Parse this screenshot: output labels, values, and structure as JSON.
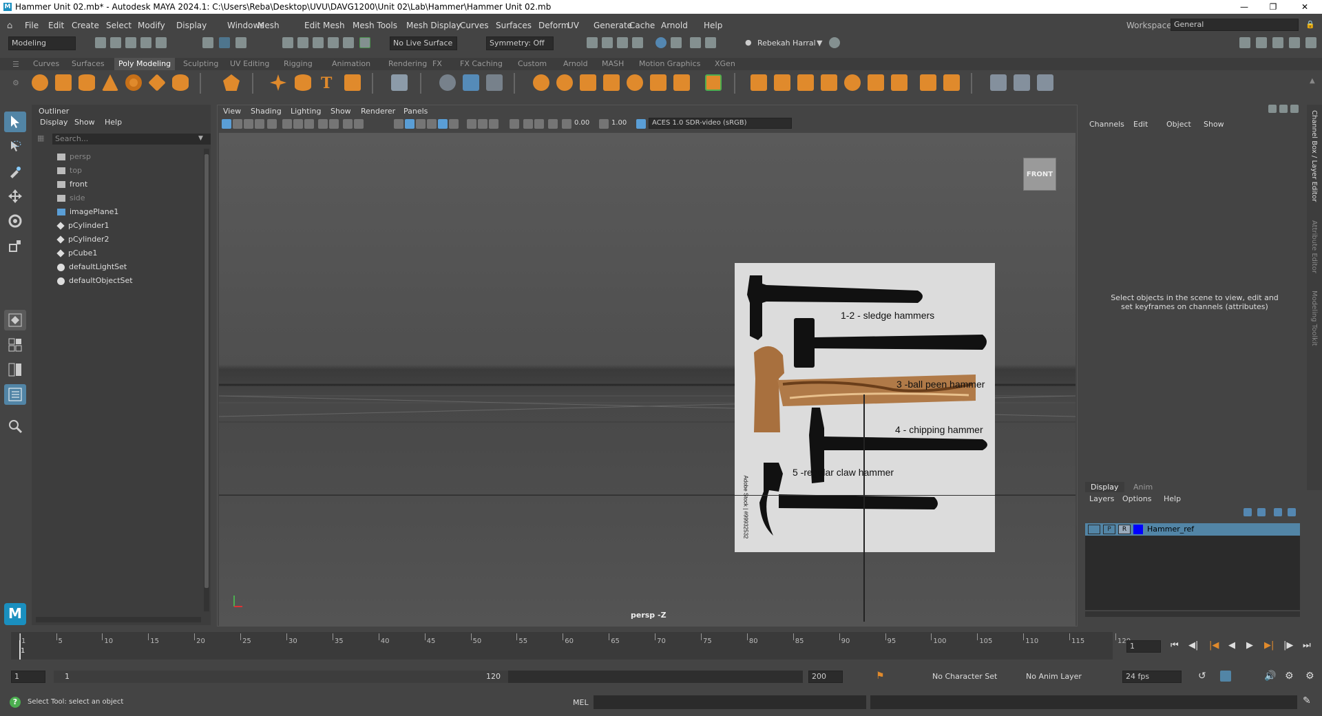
{
  "window": {
    "title": "Hammer Unit 02.mb* - Autodesk MAYA 2024.1: C:\\Users\\Reba\\Desktop\\UVU\\DAVG1200\\Unit 02\\Lab\\Hammer\\Hammer Unit 02.mb",
    "logo": "maya-logo-icon"
  },
  "menubar": {
    "items": [
      "File",
      "Edit",
      "Create",
      "Select",
      "Modify",
      "Display",
      "Windows",
      "Mesh",
      "Edit Mesh",
      "Mesh Tools",
      "Mesh Display",
      "Curves",
      "Surfaces",
      "Deform",
      "UV",
      "Generate",
      "Cache",
      "Arnold",
      "Help"
    ],
    "workspace_label": "Workspace:",
    "workspace_value": "General"
  },
  "statusline": {
    "menuset": "Modeling",
    "live_surface": "No Live Surface",
    "symmetry": "Symmetry: Off",
    "user": "Rebekah Harral"
  },
  "shelf": {
    "tabs": [
      "Curves",
      "Surfaces",
      "Poly Modeling",
      "Sculpting",
      "UV Editing",
      "Rigging",
      "Animation",
      "Rendering",
      "FX",
      "FX Caching",
      "Custom",
      "Arnold",
      "MASH",
      "Motion Graphics",
      "XGen"
    ],
    "active_tab": "Poly Modeling"
  },
  "outliner": {
    "title": "Outliner",
    "menus": [
      "Display",
      "Show",
      "Help"
    ],
    "search_placeholder": "Search...",
    "items": [
      {
        "label": "persp",
        "icon": "camera-icon",
        "dim": true
      },
      {
        "label": "top",
        "icon": "camera-icon",
        "dim": true
      },
      {
        "label": "front",
        "icon": "camera-icon",
        "dim": false
      },
      {
        "label": "side",
        "icon": "camera-icon",
        "dim": true
      },
      {
        "label": "imagePlane1",
        "icon": "image-plane-icon",
        "dim": false
      },
      {
        "label": "pCylinder1",
        "icon": "mesh-icon",
        "dim": false
      },
      {
        "label": "pCylinder2",
        "icon": "mesh-icon",
        "dim": false
      },
      {
        "label": "pCube1",
        "icon": "mesh-icon",
        "dim": false
      },
      {
        "label": "defaultLightSet",
        "icon": "set-icon",
        "dim": false
      },
      {
        "label": "defaultObjectSet",
        "icon": "set-icon",
        "dim": false
      }
    ]
  },
  "viewport": {
    "menus": [
      "View",
      "Shading",
      "Lighting",
      "Show",
      "Renderer",
      "Panels"
    ],
    "exposure": "0.00",
    "gamma": "1.00",
    "colorspace": "ACES 1.0 SDR-video (sRGB)",
    "camera_label": "persp -Z",
    "viewcube_label": "FRONT",
    "reference_labels": [
      "1-2 - sledge hammers",
      "3 -ball peen hammer",
      "4 - chipping hammer",
      "5 -regular claw hammer"
    ],
    "reference_credit": "Adobe Stock | #99932532"
  },
  "channelbox": {
    "menus": [
      "Channels",
      "Edit",
      "Object",
      "Show"
    ],
    "hint": "Select objects in the scene to view, edit and set keyframes on channels (attributes)",
    "side_tabs": [
      "Channel Box / Layer Editor",
      "Attribute Editor",
      "Modeling Toolkit"
    ]
  },
  "layers": {
    "tabs": [
      "Display",
      "Anim"
    ],
    "menus": [
      "Layers",
      "Options",
      "Help"
    ],
    "layer": {
      "v": "",
      "p": "P",
      "r": "R",
      "name": "Hammer_ref",
      "color": "#0000ff"
    }
  },
  "timeline": {
    "ticks": [
      "1",
      "5",
      "10",
      "15",
      "20",
      "25",
      "30",
      "35",
      "40",
      "45",
      "50",
      "55",
      "60",
      "65",
      "70",
      "75",
      "80",
      "85",
      "90",
      "95",
      "100",
      "105",
      "110",
      "115",
      "120"
    ],
    "current_frame": "1"
  },
  "range": {
    "start": "1",
    "range_start": "1",
    "range_end": "120",
    "end": "200",
    "character_set": "No Character Set",
    "anim_layer": "No Anim Layer",
    "fps": "24 fps"
  },
  "command": {
    "status": "Select Tool: select an object",
    "lang": "MEL"
  },
  "colors": {
    "accent": "#5285a6",
    "highlight": "#4f9fd9",
    "maya_blue": "#1a8fbf",
    "shelf_orange": "#e08a2c"
  }
}
